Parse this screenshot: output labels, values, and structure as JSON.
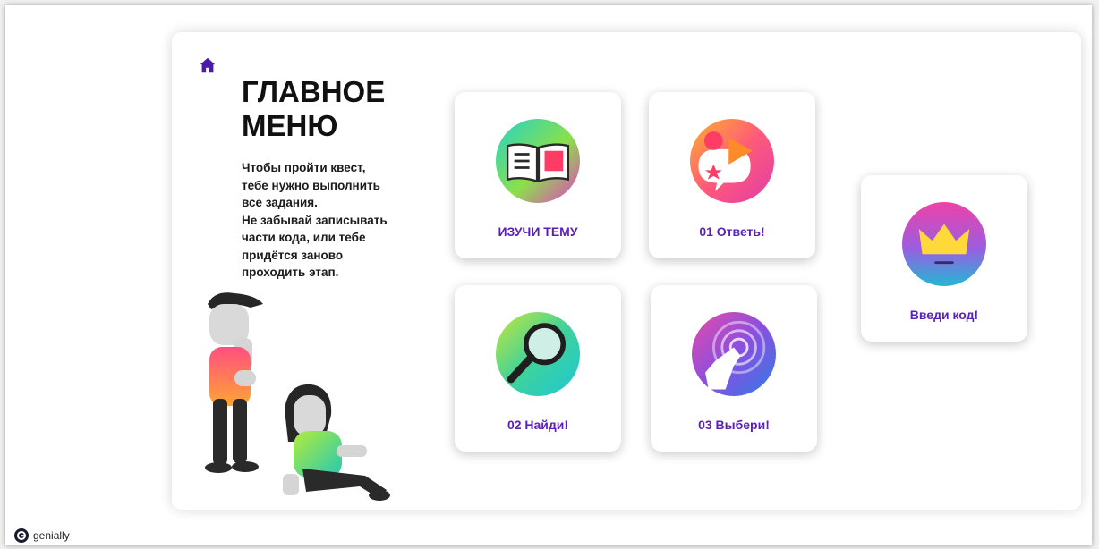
{
  "page": {
    "title_lines": [
      "ГЛАВНОЕ",
      "МЕНЮ"
    ],
    "instructions": [
      "Чтобы пройти квест,",
      "тебе нужно выполнить",
      "все задания.",
      "Не забывай записывать",
      "части кода, или тебе",
      "придётся заново",
      "проходить этап."
    ]
  },
  "cards": [
    {
      "id": "study",
      "label": "ИЗУЧИ ТЕМУ",
      "icon": "open-book-icon"
    },
    {
      "id": "answer",
      "label": "01 Ответь!",
      "icon": "shapes-chat-icon"
    },
    {
      "id": "find",
      "label": "02 Найди!",
      "icon": "magnifier-icon"
    },
    {
      "id": "choose",
      "label": "03 Выбери!",
      "icon": "touch-hand-icon"
    },
    {
      "id": "code",
      "label": "Введи код!",
      "icon": "crown-icon"
    }
  ],
  "footer": {
    "brand": "genially"
  },
  "colors": {
    "accent": "#5a1fb8",
    "home": "#4a1aa8"
  }
}
